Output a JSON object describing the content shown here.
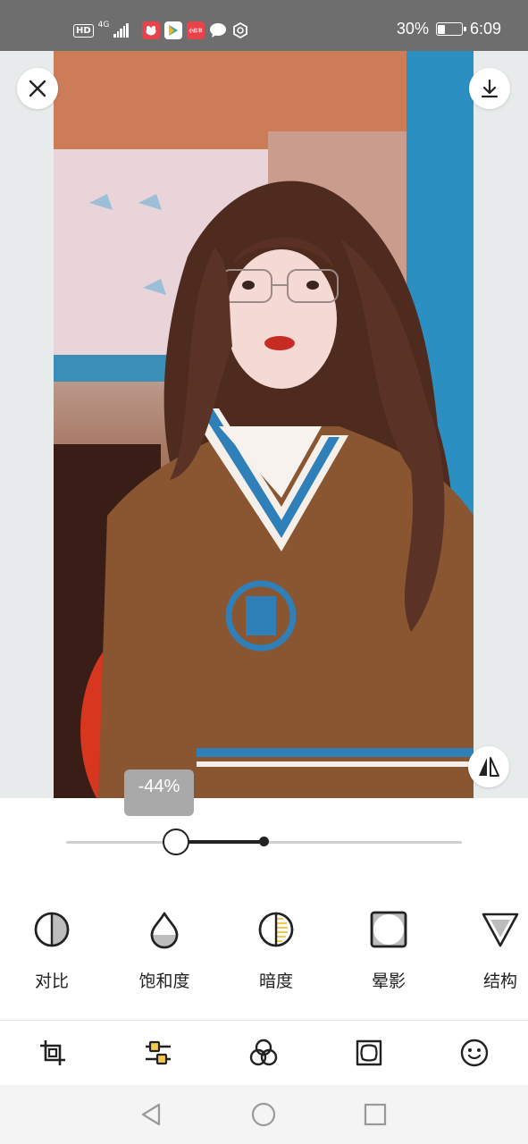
{
  "status_bar": {
    "hd": "HD",
    "network": "4G",
    "battery_percent": "30%",
    "battery_level": 0.3,
    "time": "6:09",
    "app_icons": [
      "app-red-icon",
      "play-store-icon",
      "xiaohongshu-icon",
      "chat-icon",
      "vpn-icon"
    ],
    "xhs_label": "小红书"
  },
  "viewer": {
    "close_icon": "close-icon",
    "download_icon": "download-icon",
    "compare_icon": "compare-icon"
  },
  "adjust": {
    "value_label": "-44%",
    "value": -44,
    "range": [
      -100,
      100
    ]
  },
  "tools": [
    {
      "label": "对比",
      "icon": "contrast-icon"
    },
    {
      "label": "饱和度",
      "icon": "saturation-icon"
    },
    {
      "label": "暗度",
      "icon": "darkness-icon"
    },
    {
      "label": "晕影",
      "icon": "vignette-icon"
    },
    {
      "label": "结构",
      "icon": "structure-icon"
    }
  ],
  "tabs": [
    {
      "icon": "crop-icon"
    },
    {
      "icon": "adjust-sliders-icon",
      "active": true
    },
    {
      "icon": "filters-icon"
    },
    {
      "icon": "frame-icon"
    },
    {
      "icon": "face-icon"
    }
  ],
  "colors": {
    "status_bg": "#6e6e6e",
    "accent": "#222222",
    "highlight": "#f2c94c"
  }
}
